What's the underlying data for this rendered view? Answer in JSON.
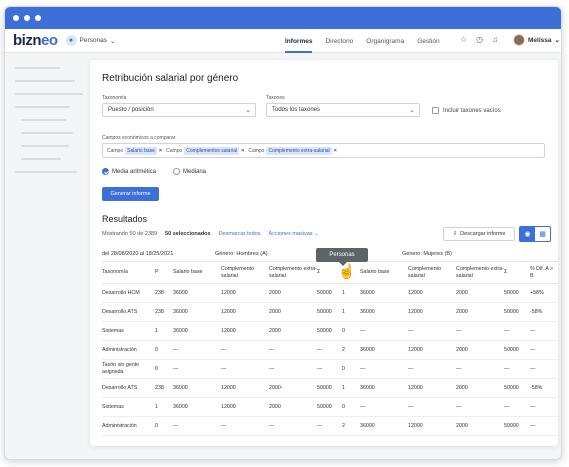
{
  "app": {
    "logo_a": "bizn",
    "logo_b": "eo",
    "module": "Personas"
  },
  "nav": {
    "links": [
      "Informes",
      "Directorio",
      "Organigrama",
      "Gestión"
    ],
    "user": "Melissa"
  },
  "report": {
    "title": "Retribución salarial por género",
    "taxonomy_label": "Taxonomía",
    "taxonomy_value": "Puesto / posición",
    "taxons_label": "Taxones",
    "taxons_value": "Todos los taxones",
    "empty_taxons_label": "Incluir taxones vacíos",
    "economic_fields_label": "Campos económicos a comparar",
    "tags": [
      {
        "prefix": "Campo",
        "name": "Salario base"
      },
      {
        "prefix": "Campo",
        "name": "Complementos salarial"
      },
      {
        "prefix": "Campo",
        "name": "Complemento extra-salarial"
      }
    ],
    "radio_mean": "Media aritmética",
    "radio_median": "Mediana",
    "generate_button": "Generar informe"
  },
  "results": {
    "title": "Resultados",
    "showing": "Mostrando 50 de 2389",
    "selected": "50 seleccionados",
    "unselect_all": "Desmarcar todos",
    "bulk_actions": "Acciones masivas",
    "download": "Descargar informe",
    "date_range": "del 28/08/2020 al 18/25/2021",
    "group_men": "Género: Hombres (A)",
    "group_women": "Género: Mujeres (B)",
    "tooltip": "Personas",
    "columns": [
      "Taxonomía",
      "P",
      "Salario base",
      "Complemento salarial",
      "Complemento extra-salarial",
      "Σ",
      "P",
      "Salario base",
      "Complemento salarial",
      "Complemento extra-salarial",
      "Σ",
      "% Dif. A > B"
    ],
    "rows": [
      [
        "Desarrollo HCM",
        "238",
        "36000",
        "12000",
        "2000",
        "50000",
        "1",
        "36000",
        "12000",
        "2000",
        "50000",
        "+58%"
      ],
      [
        "Desarrollo ATS",
        "238",
        "36000",
        "12000",
        "2000",
        "50000",
        "1",
        "36000",
        "12000",
        "2000",
        "50000",
        "-58%"
      ],
      [
        "Sistemas",
        "1",
        "36000",
        "12000",
        "2000",
        "50000",
        "0",
        "—",
        "—",
        "—",
        "—",
        "—"
      ],
      [
        "Administración",
        "0",
        "—",
        "—",
        "—",
        "—",
        "2",
        "36000",
        "12000",
        "2000",
        "50000",
        "—"
      ],
      [
        "Taxón sin gente asignada",
        "0",
        "—",
        "—",
        "—",
        "—",
        "0",
        "—",
        "—",
        "—",
        "—",
        "—"
      ],
      [
        "Desarrollo ATS",
        "238",
        "36000",
        "12000",
        "2000-",
        "50000",
        "1",
        "36000",
        "12000",
        "2000",
        "50000",
        "-58%"
      ],
      [
        "Sistemas",
        "1",
        "36000",
        "12000",
        "2000",
        "50000",
        "0",
        "—",
        "—",
        "—",
        "—",
        "—"
      ],
      [
        "Administración",
        "0",
        "—",
        "—",
        "—",
        "—",
        "2",
        "36000",
        "12000",
        "2000",
        "50000",
        "—"
      ]
    ]
  },
  "icons": [
    "star-icon",
    "clock-icon",
    "bell-icon",
    "chevron-down-icon",
    "download-icon",
    "chart-view-icon",
    "table-view-icon",
    "hand-cursor-icon"
  ],
  "colors": {
    "accent": "#3c6fd7",
    "tag_bg": "#d9e6fb"
  }
}
